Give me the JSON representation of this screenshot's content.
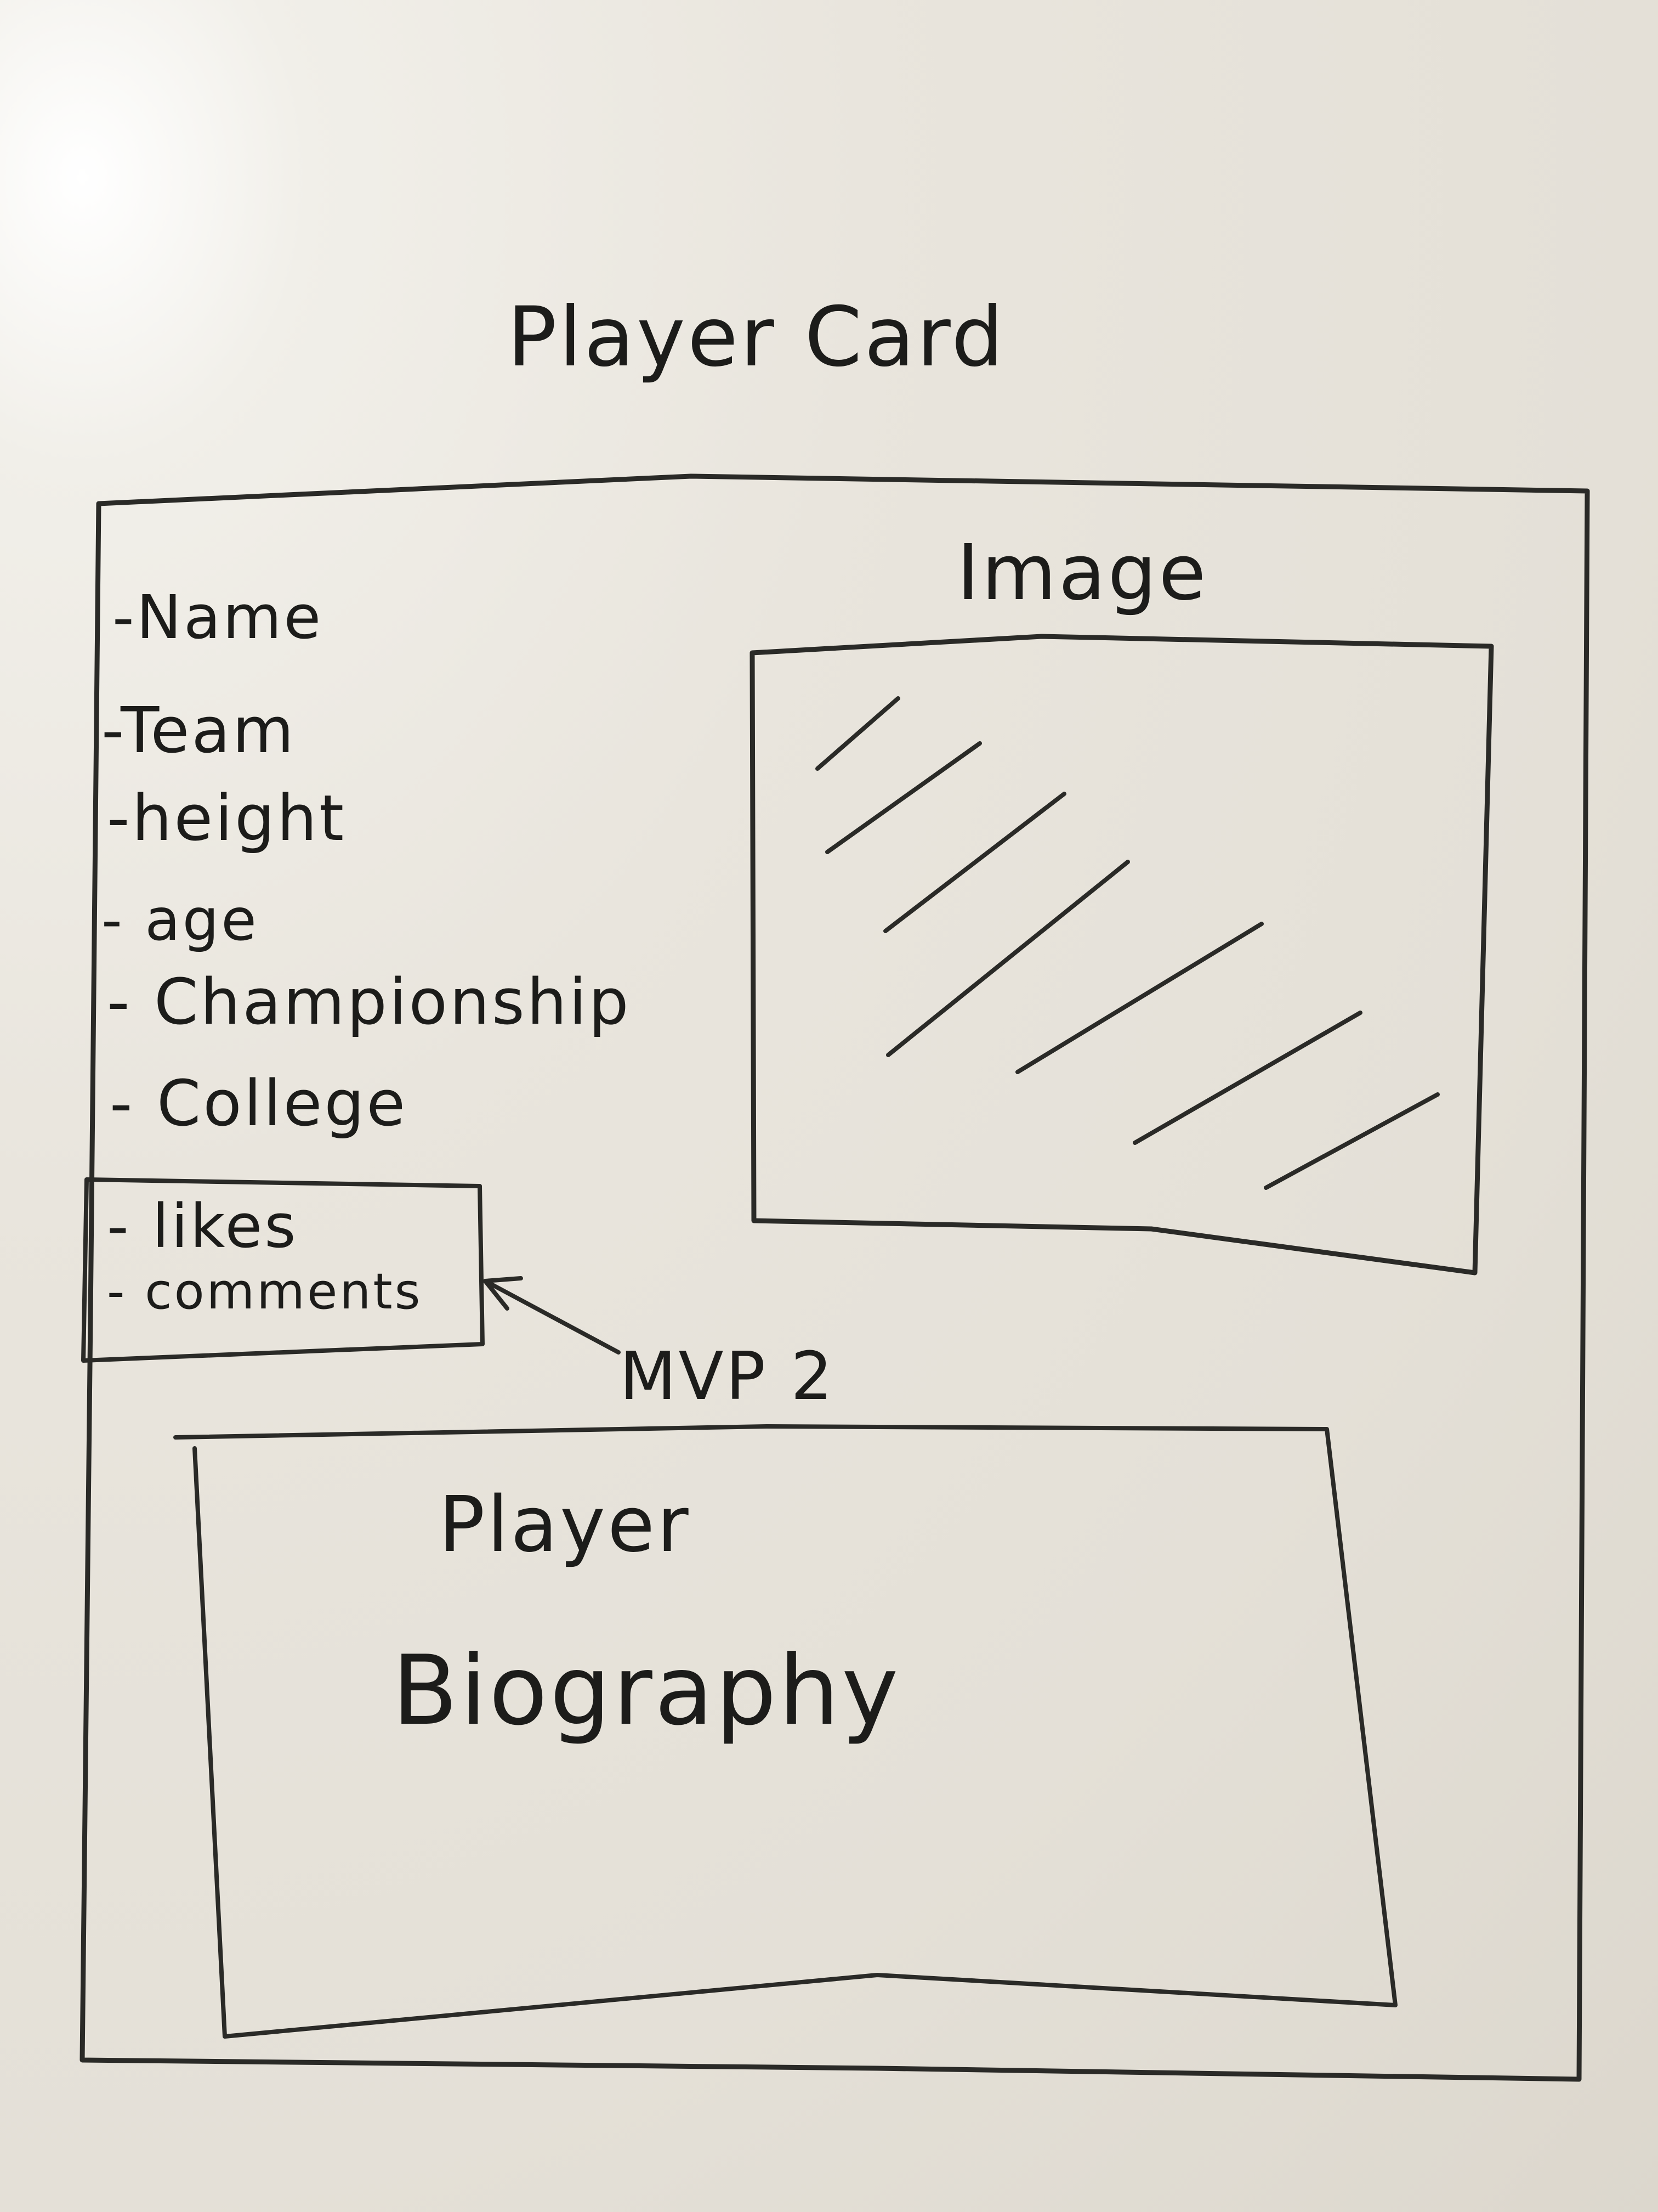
{
  "title": "Player Card",
  "fields": [
    "-Name",
    "-Team",
    "-height",
    "- age",
    "- Championship",
    "- College"
  ],
  "mvp2_fields": [
    "- likes",
    "- comments"
  ],
  "mvp2_label": "MVP 2",
  "image_label": "Image",
  "bio": {
    "line1": "Player",
    "line2": "Biography"
  },
  "colors": {
    "ink": "#2a2a27",
    "board": "#e6e2da"
  }
}
